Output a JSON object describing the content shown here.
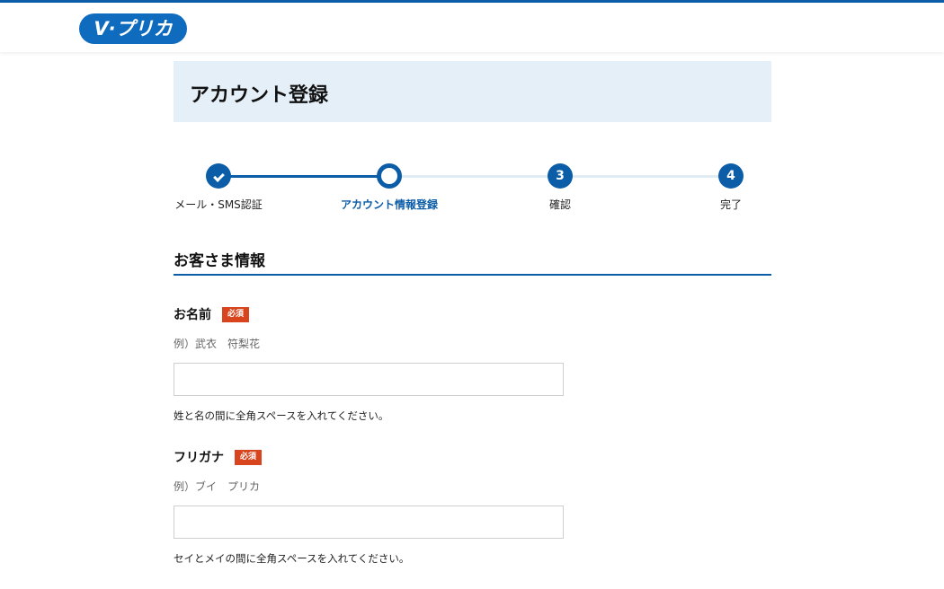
{
  "header": {
    "logo_text": "V·プリカ"
  },
  "page": {
    "title": "アカウント登録"
  },
  "steps": [
    {
      "marker": "check",
      "label": "メール・SMS認証",
      "state": "done"
    },
    {
      "marker": "",
      "label": "アカウント情報登録",
      "state": "current"
    },
    {
      "marker": "3",
      "label": "確認",
      "state": "todo"
    },
    {
      "marker": "4",
      "label": "完了",
      "state": "todo"
    }
  ],
  "section": {
    "title": "お客さま情報"
  },
  "fields": {
    "name": {
      "label": "お名前",
      "required": "必須",
      "example": "例）武衣　符梨花",
      "value": "",
      "hint": "姓と名の間に全角スペースを入れてください。"
    },
    "kana": {
      "label": "フリガナ",
      "required": "必須",
      "example": "例）ブイ　プリカ",
      "value": "",
      "hint": "セイとメイの間に全角スペースを入れてください。"
    }
  },
  "colors": {
    "brand": "#0b5da8",
    "header_bg": "#e5eff8",
    "required": "#d7441e"
  }
}
